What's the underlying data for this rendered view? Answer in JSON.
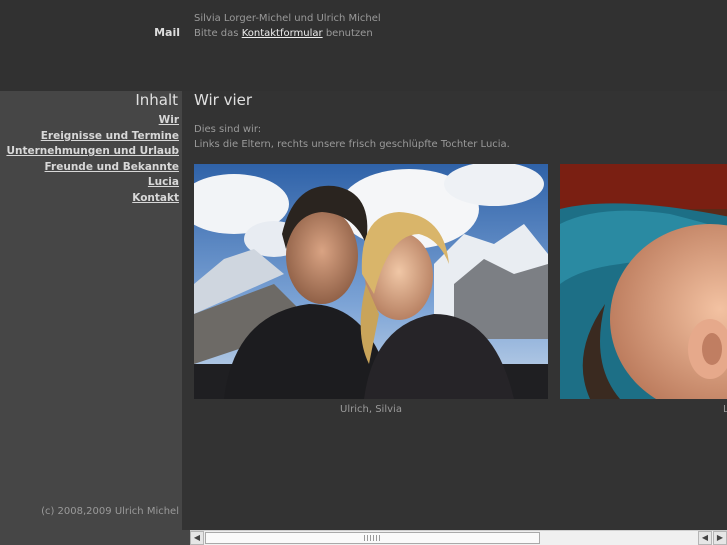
{
  "header": {
    "mail_label": "Mail",
    "names": "Silvia Lorger-Michel und Ulrich Michel",
    "contact_prefix": "Bitte das",
    "contact_link": "Kontaktformular",
    "contact_suffix": "benutzen"
  },
  "sidebar": {
    "title": "Inhalt",
    "items": [
      {
        "label": "Wir"
      },
      {
        "label": "Ereignisse und Termine"
      },
      {
        "label": "Unternehmungen und Urlaub"
      },
      {
        "label": "Freunde und Bekannte"
      },
      {
        "label": "Lucia"
      },
      {
        "label": "Kontakt"
      }
    ],
    "copyright": "(c) 2008,2009 Ulrich Michel"
  },
  "main": {
    "title": "Wir vier",
    "intro_line1": "Dies sind wir:",
    "intro_line2": "Links die Eltern, rechts unsere frisch geschlüpfte Tochter Lucia.",
    "photos": [
      {
        "caption": "Ulrich, Silvia"
      },
      {
        "caption": "L"
      }
    ]
  },
  "scrollbar": {
    "left_arrow": "◀",
    "right_arrow": "▶",
    "thumb_fraction": 0.68
  },
  "colors": {
    "background": "#333333",
    "sidebar": "#464646",
    "link": "#d8d8d8"
  }
}
